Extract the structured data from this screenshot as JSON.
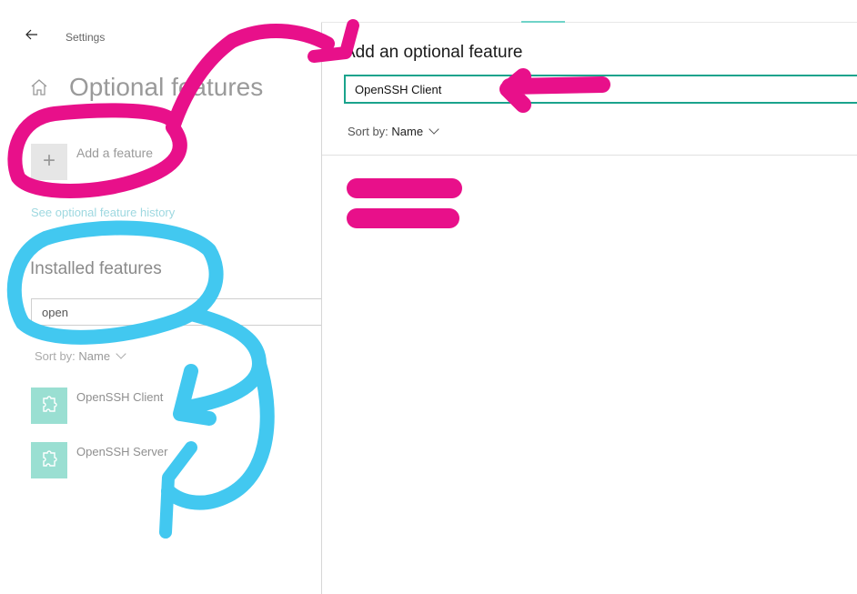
{
  "header": {
    "title": "Settings",
    "back_icon": "arrow-left-icon"
  },
  "page": {
    "title": "Optional features",
    "home_icon": "home-icon"
  },
  "add_feature": {
    "label": "Add a feature",
    "icon": "plus-icon"
  },
  "history_link": "See optional feature history",
  "installed": {
    "heading": "Installed features",
    "search_value": "open",
    "sort_prefix": "Sort by: ",
    "sort_value": "Name",
    "items": [
      {
        "label": "OpenSSH Client",
        "icon": "puzzle-icon"
      },
      {
        "label": "OpenSSH Server",
        "icon": "puzzle-icon"
      }
    ]
  },
  "dialog": {
    "title": "Add an optional feature",
    "search_value": "OpenSSH Client",
    "sort_prefix": "Sort by: ",
    "sort_value": "Name"
  },
  "annotations": {
    "magenta": "#e8108a",
    "cyan": "#42c8f0"
  },
  "colors": {
    "accent": "#1aa38c",
    "feature_icon_bg": "#9adfd2"
  }
}
